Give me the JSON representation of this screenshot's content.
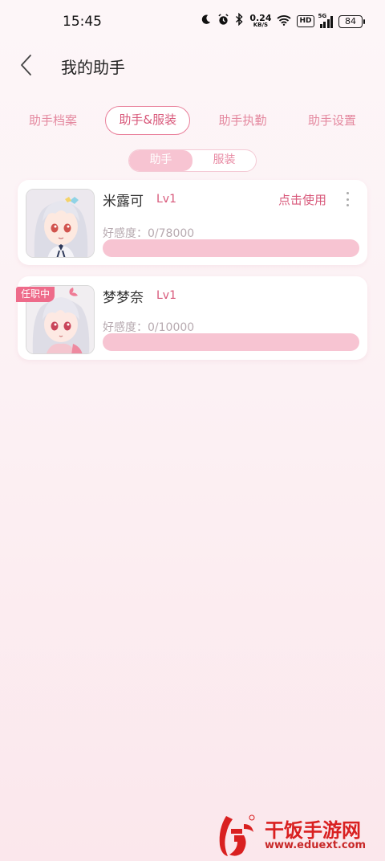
{
  "status_bar": {
    "time": "15:45",
    "speed_value": "0.24",
    "speed_unit": "KB/S",
    "hd_label": "HD",
    "network_label": "5G",
    "battery": "84",
    "icons": [
      "moon-icon",
      "alarm-icon",
      "bluetooth-icon",
      "wifi-icon",
      "signal-icon",
      "battery-icon"
    ]
  },
  "header": {
    "title": "我的助手",
    "back_icon": "chevron-left-icon"
  },
  "tabs": [
    {
      "label": "助手档案",
      "active": false
    },
    {
      "label": "助手&服装",
      "active": true
    },
    {
      "label": "助手执勤",
      "active": false
    },
    {
      "label": "助手设置",
      "active": false
    }
  ],
  "segment": {
    "options": [
      "助手",
      "服装"
    ],
    "selected": "助手"
  },
  "assistants": [
    {
      "name": "米露可",
      "level": "Lv1",
      "action": "点击使用",
      "favor_label": "好感度：0/78000",
      "favor_progress": 0,
      "on_duty": false
    },
    {
      "name": "梦梦奈",
      "level": "Lv1",
      "favor_label": "好感度：0/10000",
      "favor_progress": 0,
      "on_duty": true,
      "badge": "任职中"
    }
  ],
  "watermark": {
    "name": "干饭手游网",
    "url": "www.eduext.com"
  },
  "colors": {
    "accent": "#d8587a",
    "accent_light": "#f7c4d2",
    "badge": "#ee6b8a",
    "watermark": "#d92020"
  }
}
